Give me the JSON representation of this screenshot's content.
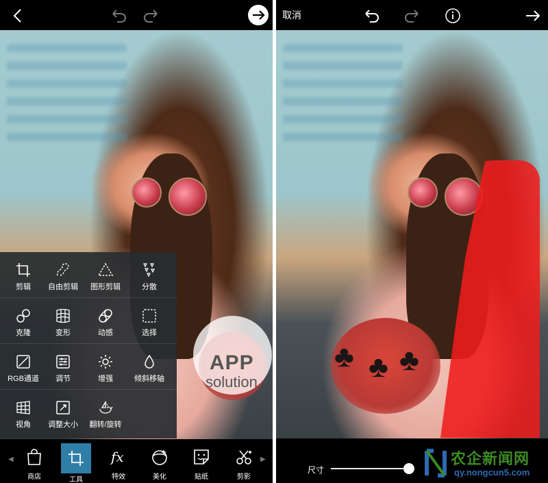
{
  "left_screen": {
    "menu": {
      "rows": [
        [
          {
            "label": "剪辑",
            "icon": "crop-icon"
          },
          {
            "label": "自由剪辑",
            "icon": "free-crop-icon"
          },
          {
            "label": "图形剪辑",
            "icon": "shape-crop-icon"
          },
          {
            "label": "分散",
            "icon": "disperse-icon"
          }
        ],
        [
          {
            "label": "克隆",
            "icon": "clone-icon"
          },
          {
            "label": "变形",
            "icon": "warp-icon"
          },
          {
            "label": "动感",
            "icon": "motion-icon"
          },
          {
            "label": "选择",
            "icon": "select-icon"
          }
        ],
        [
          {
            "label": "RGB通道",
            "icon": "curves-icon"
          },
          {
            "label": "调节",
            "icon": "adjust-icon"
          },
          {
            "label": "增强",
            "icon": "enhance-icon"
          },
          {
            "label": "倾斜移轴",
            "icon": "tilt-shift-icon"
          }
        ],
        [
          {
            "label": "视角",
            "icon": "perspective-icon"
          },
          {
            "label": "调整大小",
            "icon": "resize-icon"
          },
          {
            "label": "翻转/旋转",
            "icon": "flip-rotate-icon"
          }
        ]
      ]
    },
    "toolbar": {
      "items": [
        {
          "label": "商店",
          "icon": "shop-bag-icon"
        },
        {
          "label": "工具",
          "icon": "tools-crop-icon",
          "active": true
        },
        {
          "label": "特效",
          "icon": "fx-icon"
        },
        {
          "label": "美化",
          "icon": "beautify-icon"
        },
        {
          "label": "贴纸",
          "icon": "sticker-icon"
        },
        {
          "label": "剪影",
          "icon": "cutout-icon"
        }
      ]
    }
  },
  "right_screen": {
    "cancel_label": "取消",
    "size_label": "尺寸",
    "brush_size": 0.95
  },
  "watermark": {
    "line1": "APP",
    "line2": "solution"
  },
  "brand": {
    "name": "农企新闻网",
    "url": "qy.nongcun5.com"
  },
  "colors": {
    "mask_red": "#ee1c1c",
    "active_tool": "#2f7ea8",
    "brand_green": "#3c8c22",
    "brand_blue": "#2d6ab2"
  }
}
